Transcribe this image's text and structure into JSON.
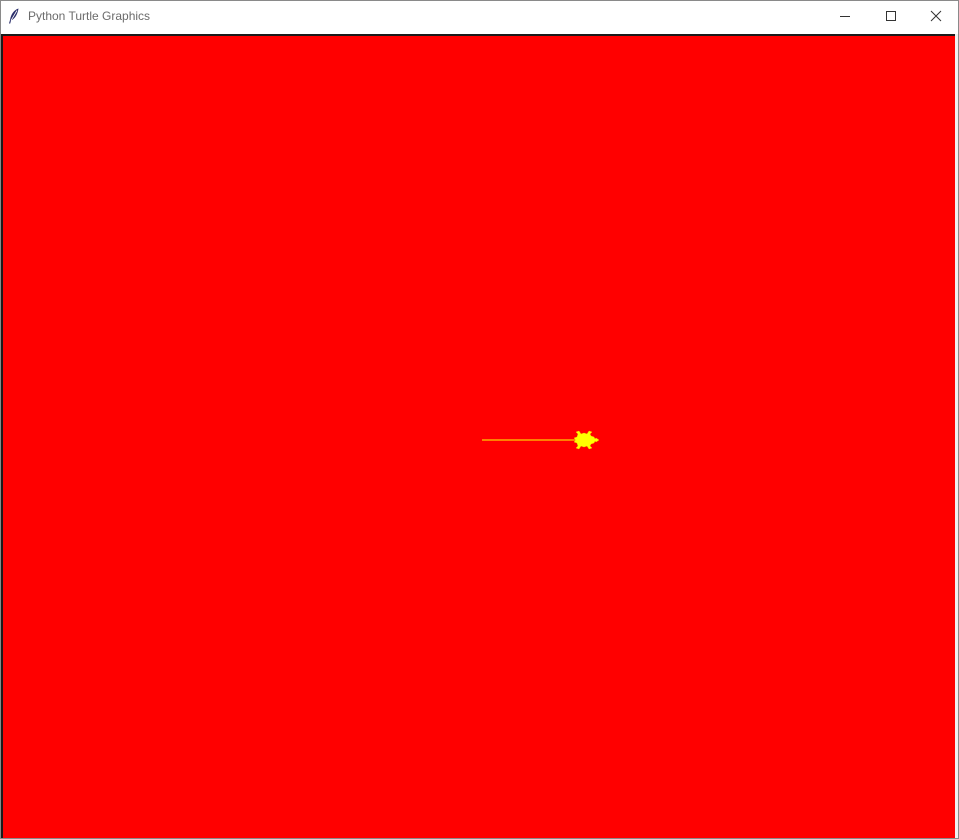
{
  "window": {
    "title": "Python Turtle Graphics",
    "icon": "feather-icon",
    "controls": {
      "minimize_icon": "minimize-icon",
      "maximize_icon": "maximize-icon",
      "close_icon": "close-icon"
    }
  },
  "canvas": {
    "background_color": "#ff0000",
    "pen_color": "#ffff00",
    "turtle_color": "#ffff00",
    "turtle_shape": "turtle",
    "turtle_heading": "east"
  }
}
